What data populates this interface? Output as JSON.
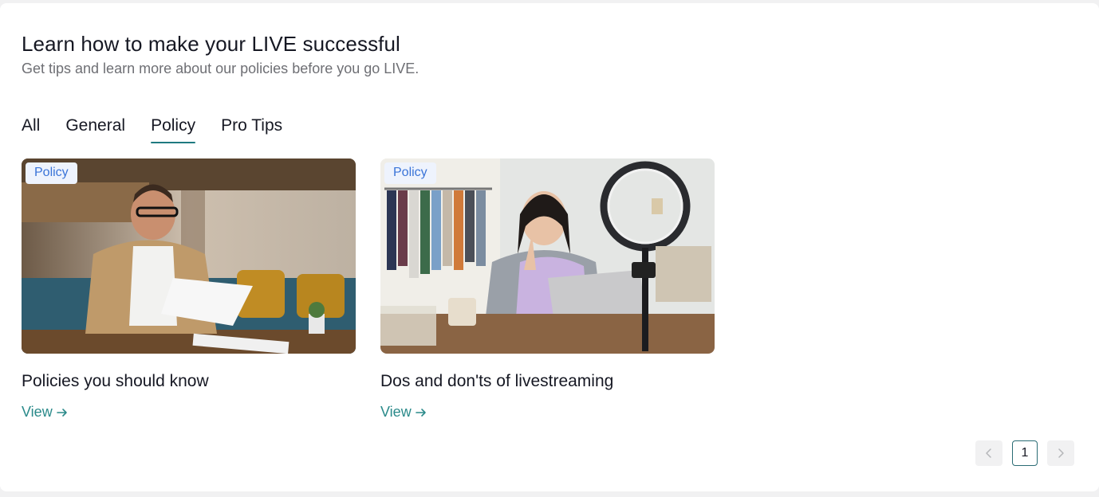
{
  "header": {
    "title": "Learn how to make your LIVE successful",
    "subtitle": "Get tips and learn more about our policies before you go LIVE."
  },
  "tabs": [
    {
      "label": "All",
      "active": false
    },
    {
      "label": "General",
      "active": false
    },
    {
      "label": "Policy",
      "active": true
    },
    {
      "label": "Pro Tips",
      "active": false
    }
  ],
  "cards": [
    {
      "badge": "Policy",
      "title": "Policies you should know",
      "link_label": "View",
      "image_icon": "man-reading-papers-photo"
    },
    {
      "badge": "Policy",
      "title": "Dos and don'ts of livestreaming",
      "link_label": "View",
      "image_icon": "woman-livestreaming-ringlight-photo"
    }
  ],
  "pagination": {
    "current_page": "1",
    "prev_icon": "chevron-left-icon",
    "next_icon": "chevron-right-icon"
  },
  "colors": {
    "accent": "#1f7a80",
    "link": "#2a8a8a",
    "badge_text": "#3a74d8",
    "badge_bg": "#eef3fd"
  }
}
